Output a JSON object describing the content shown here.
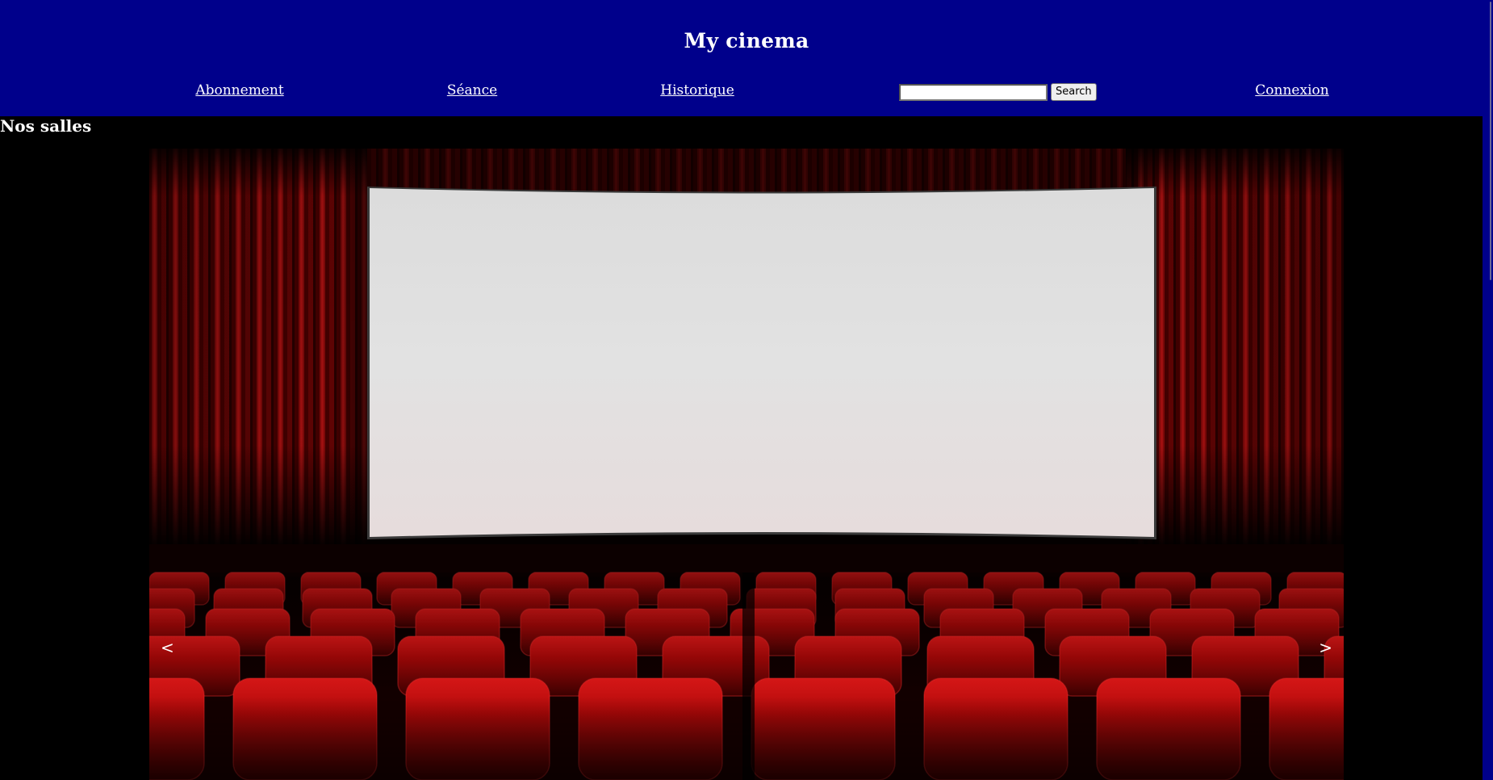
{
  "header": {
    "title": "My cinema",
    "background_color": "#00008b",
    "nav": {
      "abonnement": "Abonnement",
      "seance": "Séance",
      "historique": "Historique",
      "connexion": "Connexion"
    },
    "search": {
      "value": "",
      "placeholder": "",
      "button_label": "Search"
    }
  },
  "main": {
    "section_title": "Nos salles",
    "carousel": {
      "prev_label": "<",
      "next_label": ">",
      "slide_image": "cinema-hall-photo",
      "slide_image_alt": ""
    }
  },
  "colors": {
    "page_background": "#000000",
    "curtain_red": "#8b0000",
    "seat_red": "#c00000",
    "screen_white": "#e0e0e0"
  }
}
